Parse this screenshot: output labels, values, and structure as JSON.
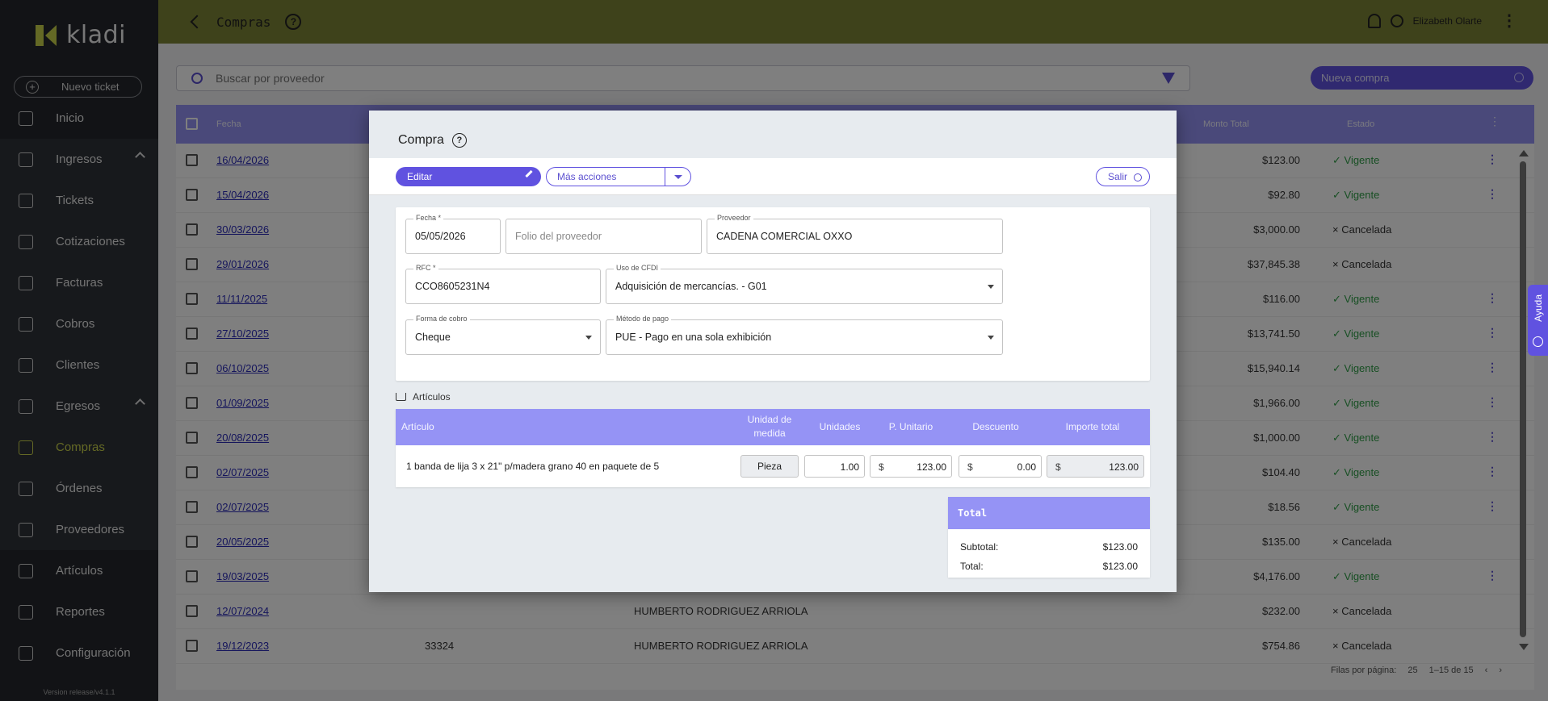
{
  "brand": {
    "name": "kladi",
    "version": "Version release/v4.1.1",
    "logo_color": "#c9d24a"
  },
  "sidebar": {
    "new_ticket": "Nuevo ticket",
    "items": [
      {
        "label": "Inicio",
        "icon": "home-icon"
      },
      {
        "label": "Ingresos",
        "icon": "income-icon"
      },
      {
        "label": "Tickets",
        "icon": "ticket-icon"
      },
      {
        "label": "Cotizaciones",
        "icon": "quote-icon"
      },
      {
        "label": "Facturas",
        "icon": "invoice-icon"
      },
      {
        "label": "Cobros",
        "icon": "cash-icon"
      },
      {
        "label": "Clientes",
        "icon": "clients-icon"
      },
      {
        "label": "Egresos",
        "icon": "expenses-icon"
      },
      {
        "label": "Compras",
        "icon": "box-icon"
      },
      {
        "label": "Órdenes",
        "icon": "orders-icon"
      },
      {
        "label": "Proveedores",
        "icon": "suppliers-icon"
      },
      {
        "label": "Artículos",
        "icon": "tag-icon"
      },
      {
        "label": "Reportes",
        "icon": "reports-icon"
      },
      {
        "label": "Configuración",
        "icon": "gear-icon"
      }
    ]
  },
  "topbar": {
    "title": "Compras",
    "user": "Elizabeth Olarte",
    "color": "#7d8436"
  },
  "search": {
    "placeholder": "Buscar por proveedor"
  },
  "new_purchase": "Nueva compra",
  "table": {
    "headers": {
      "date": "Fecha",
      "total": "Monto Total",
      "status": "Estado"
    },
    "rows": [
      {
        "date": "16/04/2026",
        "folio": "",
        "provider": "",
        "total": "$123.00",
        "status": "✓ Vigente"
      },
      {
        "date": "15/04/2026",
        "folio": "",
        "provider": "",
        "total": "$92.80",
        "status": "✓ Vigente"
      },
      {
        "date": "30/03/2026",
        "folio": "",
        "provider": "",
        "total": "$3,000.00",
        "status": "× Cancelada"
      },
      {
        "date": "29/01/2026",
        "folio": "",
        "provider": "",
        "total": "$37,845.38",
        "status": "× Cancelada"
      },
      {
        "date": "11/11/2025",
        "folio": "",
        "provider": "",
        "total": "$116.00",
        "status": "✓ Vigente"
      },
      {
        "date": "27/10/2025",
        "folio": "",
        "provider": "",
        "total": "$13,741.50",
        "status": "✓ Vigente"
      },
      {
        "date": "06/10/2025",
        "folio": "",
        "provider": "",
        "total": "$15,940.14",
        "status": "✓ Vigente"
      },
      {
        "date": "01/09/2025",
        "folio": "",
        "provider": "",
        "total": "$1,966.00",
        "status": "✓ Vigente"
      },
      {
        "date": "20/08/2025",
        "folio": "",
        "provider": "",
        "total": "$1,000.00",
        "status": "✓ Vigente"
      },
      {
        "date": "02/07/2025",
        "folio": "",
        "provider": "",
        "total": "$104.40",
        "status": "✓ Vigente"
      },
      {
        "date": "02/07/2025",
        "folio": "",
        "provider": "",
        "total": "$18.56",
        "status": "✓ Vigente"
      },
      {
        "date": "20/05/2025",
        "folio": "",
        "provider": "",
        "total": "$135.00",
        "status": "× Cancelada"
      },
      {
        "date": "19/03/2025",
        "folio": "",
        "provider": "",
        "total": "$4,176.00",
        "status": "✓ Vigente"
      },
      {
        "date": "12/07/2024",
        "folio": "",
        "provider": "HUMBERTO RODRIGUEZ ARRIOLA",
        "total": "$232.00",
        "status": "× Cancelada"
      },
      {
        "date": "19/12/2023",
        "folio": "33324",
        "provider": "HUMBERTO RODRIGUEZ ARRIOLA",
        "total": "$754.86",
        "status": "× Cancelada"
      }
    ],
    "pager": {
      "rows_per_page_label": "Filas por página:",
      "rows_per_page": "25",
      "range": "1–15 de 15"
    }
  },
  "modal": {
    "title": "Compra",
    "edit": "Editar",
    "more_actions": "Más acciones",
    "exit": "Salir",
    "fields": {
      "fecha_label": "Fecha *",
      "fecha": "05/05/2026",
      "folio_placeholder": "Folio del proveedor",
      "proveedor_label": "Proveedor",
      "proveedor": "CADENA COMERCIAL OXXO",
      "rfc_label": "RFC *",
      "rfc": "CCO8605231N4",
      "cfdi_label": "Uso de CFDI",
      "cfdi": "Adquisición de mercancías. - G01",
      "cobro_label": "Forma de cobro",
      "cobro": "Cheque",
      "metodo_label": "Método de pago",
      "metodo": "PUE - Pago en una sola exhibición"
    },
    "articles_label": "Artículos",
    "items_headers": {
      "article": "Artículo",
      "unit": "Unidad de medida",
      "units": "Unidades",
      "unit_price": "P. Unitario",
      "discount": "Descuento",
      "total": "Importe total"
    },
    "item": {
      "name": "1 banda de lija 3 x 21\" p/madera grano 40 en paquete de 5",
      "unit": "Pieza",
      "units": "1.00",
      "currency": "$",
      "unit_price": "123.00",
      "discount": "0.00",
      "total": "123.00"
    },
    "totals": {
      "header": "Total",
      "subtotal_label": "Subtotal:",
      "subtotal": "$123.00",
      "total_label": "Total:",
      "total": "$123.00"
    }
  },
  "help_tab": "Ayuda",
  "accent": "#6052e0",
  "header_purple": "#9593f5"
}
